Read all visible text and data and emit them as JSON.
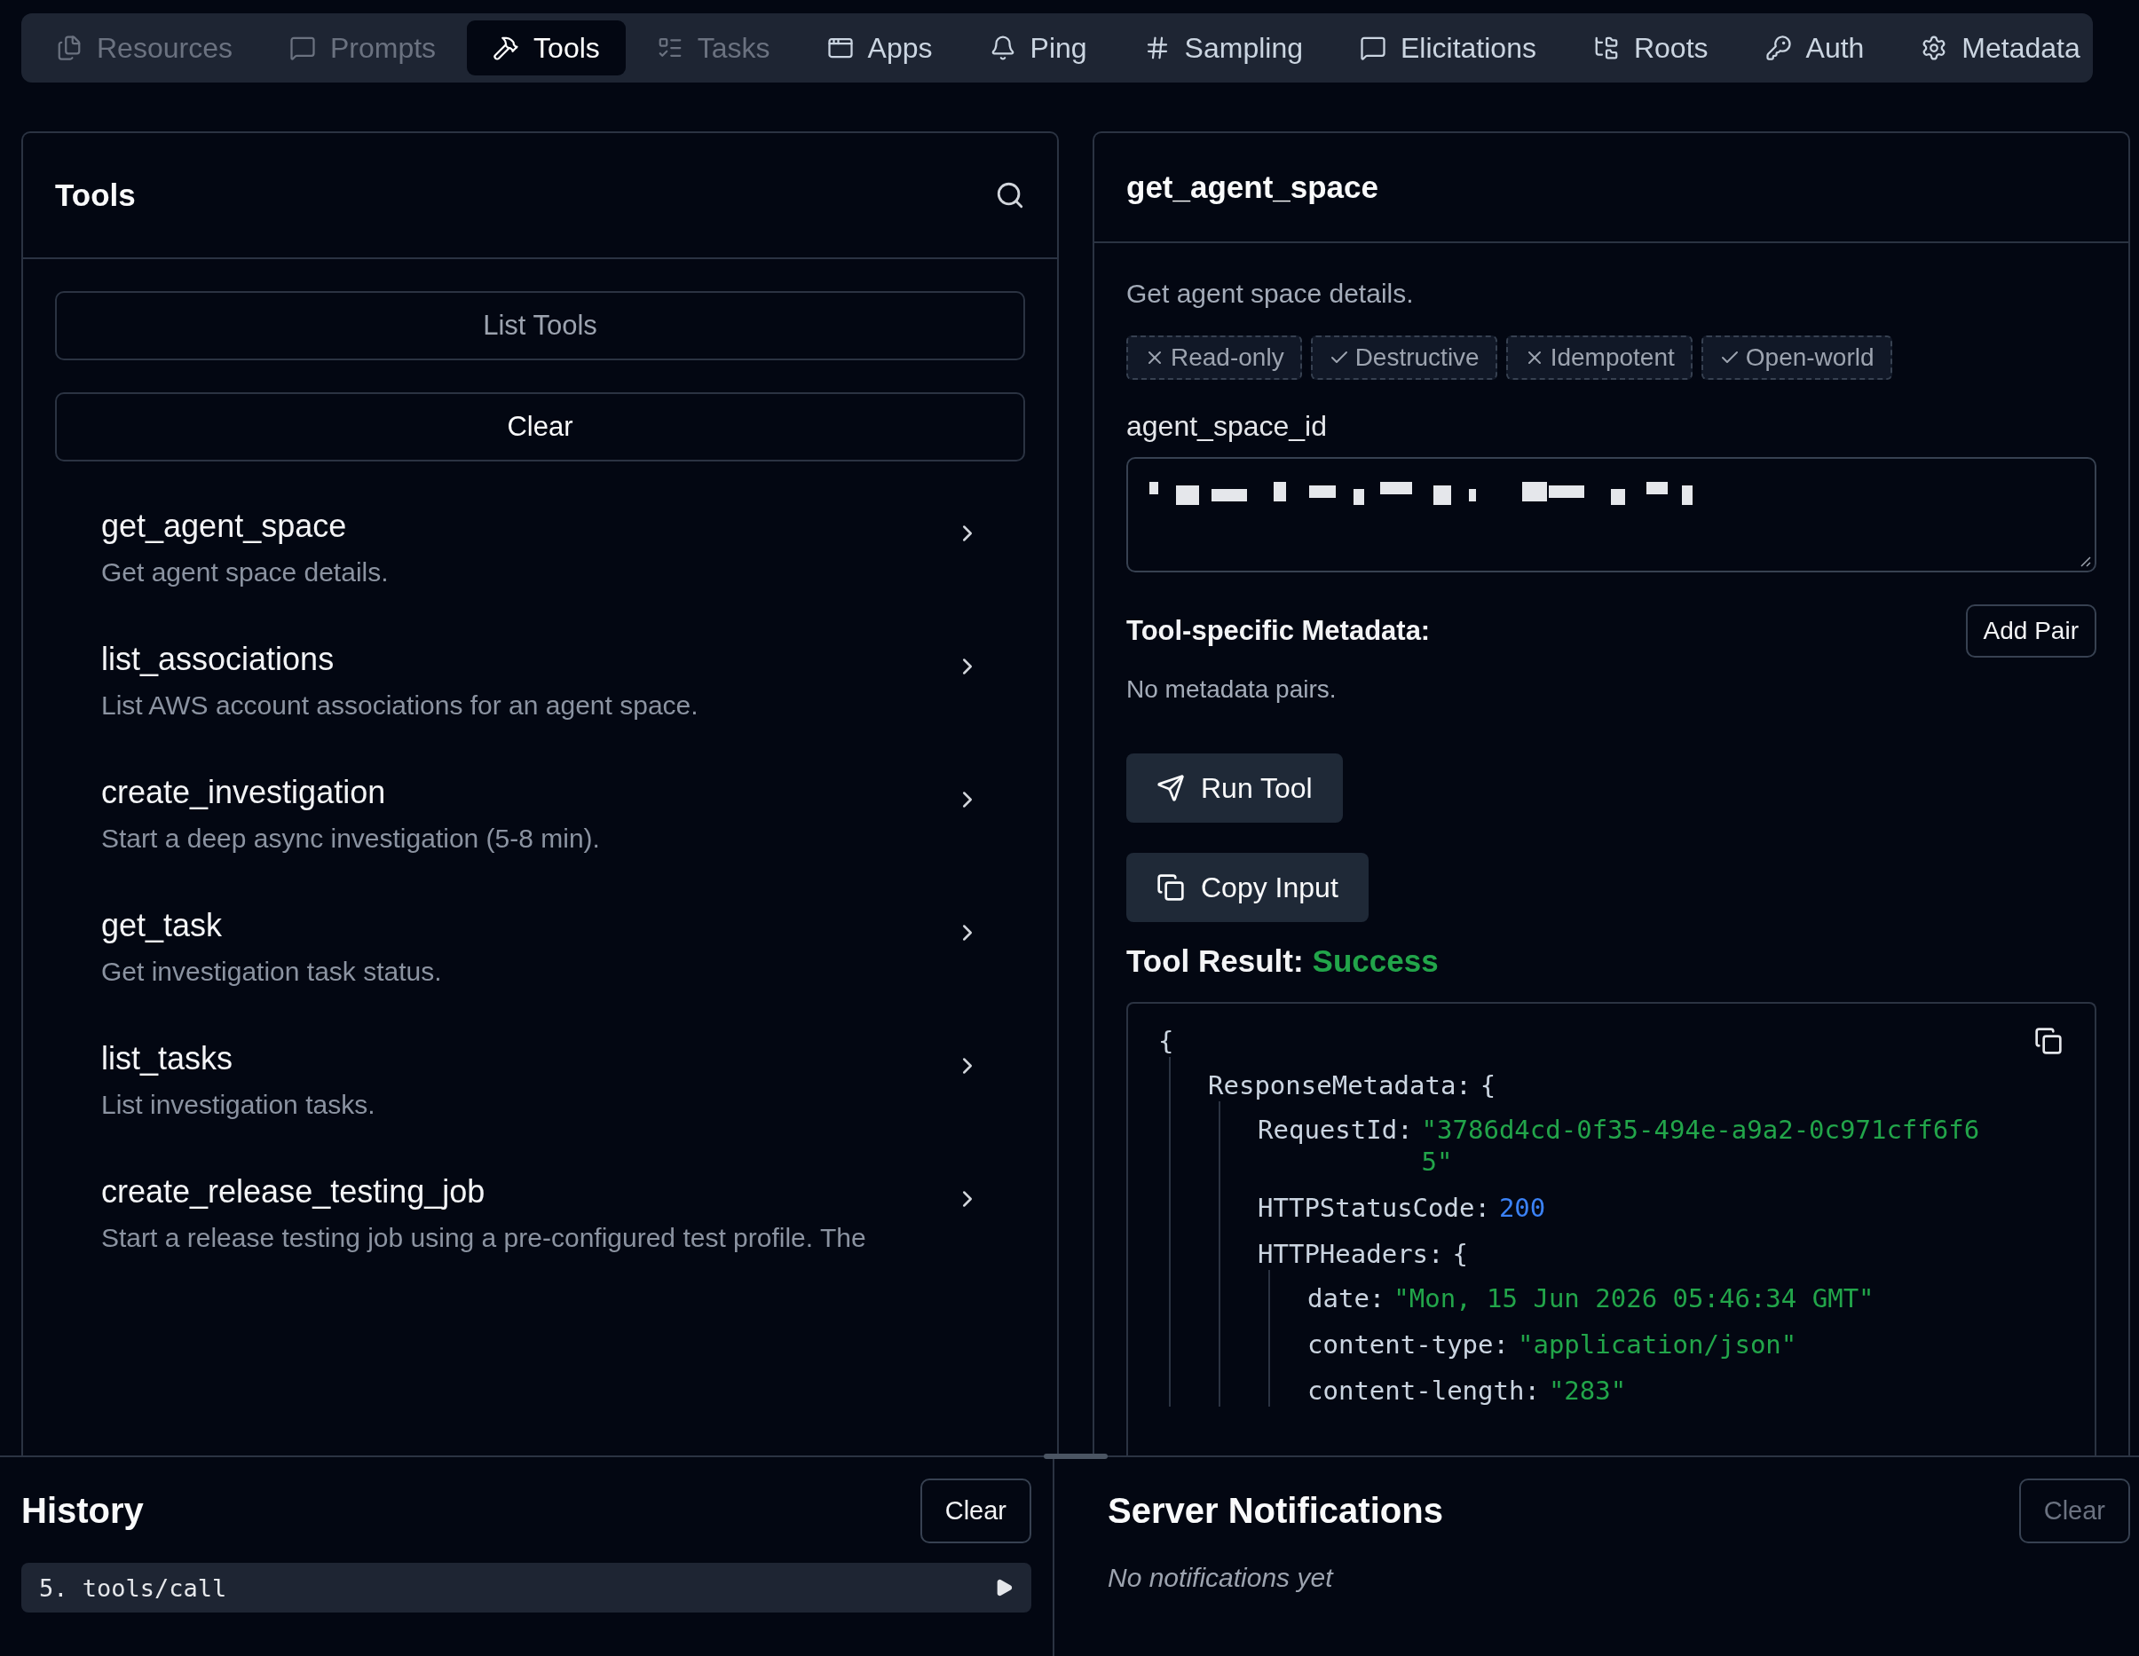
{
  "tabs": [
    {
      "label": "Resources",
      "kind": "files",
      "selected": false,
      "disabled": true
    },
    {
      "label": "Prompts",
      "kind": "message",
      "selected": false,
      "disabled": true
    },
    {
      "label": "Tools",
      "kind": "hammer",
      "selected": true,
      "disabled": false
    },
    {
      "label": "Tasks",
      "kind": "list",
      "selected": false,
      "disabled": true
    },
    {
      "label": "Apps",
      "kind": "app",
      "selected": false,
      "disabled": false
    },
    {
      "label": "Ping",
      "kind": "bell",
      "selected": false,
      "disabled": false
    },
    {
      "label": "Sampling",
      "kind": "hash",
      "selected": false,
      "disabled": false
    },
    {
      "label": "Elicitations",
      "kind": "message",
      "selected": false,
      "disabled": false
    },
    {
      "label": "Roots",
      "kind": "tree",
      "selected": false,
      "disabled": false
    },
    {
      "label": "Auth",
      "kind": "key",
      "selected": false,
      "disabled": false
    },
    {
      "label": "Metadata",
      "kind": "gear",
      "selected": false,
      "disabled": false
    }
  ],
  "tools_panel": {
    "title": "Tools",
    "buttons": [
      {
        "label": "List Tools",
        "disabled": true
      },
      {
        "label": "Clear",
        "disabled": false
      }
    ],
    "tools": [
      {
        "name": "get_agent_space",
        "description": "Get agent space details."
      },
      {
        "name": "list_associations",
        "description": "List AWS account associations for an agent space."
      },
      {
        "name": "create_investigation",
        "description": "Start a deep async investigation (5-8 min)."
      },
      {
        "name": "get_task",
        "description": "Get investigation task status."
      },
      {
        "name": "list_tasks",
        "description": "List investigation tasks."
      },
      {
        "name": "create_release_testing_job",
        "description": "Start a release testing job using a pre-configured test profile. The"
      }
    ]
  },
  "tool_detail": {
    "title": "get_agent_space",
    "description": "Get agent space details.",
    "annotations": [
      {
        "label": "Read-only",
        "on": false
      },
      {
        "label": "Destructive",
        "on": true
      },
      {
        "label": "Idempotent",
        "on": false
      },
      {
        "label": "Open-world",
        "on": true
      }
    ],
    "field_label": "agent_space_id",
    "metadata_label": "Tool-specific Metadata:",
    "add_pair": "Add Pair",
    "metadata_empty": "No metadata pairs.",
    "run_button": "Run Tool",
    "copy_button": "Copy Input",
    "result_label": "Tool Result:",
    "result_status": "Success",
    "result_json": {
      "open": "{",
      "children": [
        {
          "key": "ResponseMetadata:",
          "kind": "object",
          "open": "{",
          "children": [
            {
              "key": "RequestId:",
              "kind": "string",
              "value": "\"3786d4cd-0f35-494e-a9a2-0c971cff6f65\""
            },
            {
              "key": "HTTPStatusCode:",
              "kind": "number",
              "value": "200"
            },
            {
              "key": "HTTPHeaders:",
              "kind": "object",
              "open": "{",
              "children": [
                {
                  "key": "date:",
                  "kind": "string",
                  "value": "\"Mon, 15 Jun 2026 05:46:34 GMT\""
                },
                {
                  "key": "content-type:",
                  "kind": "string",
                  "value": "\"application/json\""
                },
                {
                  "key": "content-length:",
                  "kind": "string",
                  "value": "\"283\""
                }
              ]
            }
          ]
        }
      ]
    }
  },
  "history": {
    "title": "History",
    "clear": "Clear",
    "items": [
      {
        "label": "5. tools/call"
      }
    ]
  },
  "notifications": {
    "title": "Server Notifications",
    "clear": "Clear",
    "clear_disabled": true,
    "empty": "No notifications yet"
  }
}
